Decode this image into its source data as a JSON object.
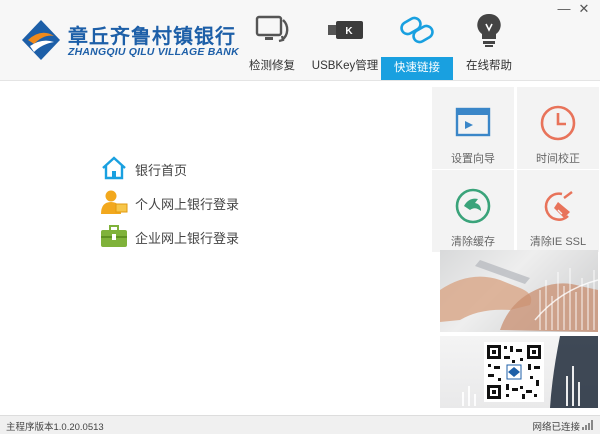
{
  "window": {
    "minimize_label": "—",
    "close_label": "✕"
  },
  "brand": {
    "name_cn": "章丘齐鲁村镇银行",
    "name_en": "ZHANGQIU QILU VILLAGE BANK"
  },
  "nav": [
    {
      "label": "检测修复",
      "icon": "monitor-repair-icon",
      "active": false
    },
    {
      "label": "USBKey管理",
      "icon": "usb-key-icon",
      "active": false
    },
    {
      "label": "快速链接",
      "icon": "link-icon",
      "active": true
    },
    {
      "label": "在线帮助",
      "icon": "lightbulb-icon",
      "active": false
    }
  ],
  "links": [
    {
      "label": "银行首页",
      "icon": "home-icon"
    },
    {
      "label": "个人网上银行登录",
      "icon": "personal-user-icon"
    },
    {
      "label": "企业网上银行登录",
      "icon": "briefcase-icon"
    }
  ],
  "tiles": [
    {
      "label": "设置向导",
      "icon": "setup-wizard-icon"
    },
    {
      "label": "时间校正",
      "icon": "clock-icon"
    },
    {
      "label": "清除缓存",
      "icon": "clear-cache-icon"
    },
    {
      "label": "清除IE SSL",
      "icon": "clear-ssl-icon"
    }
  ],
  "status": {
    "version": "主程序版本1.0.20.0513",
    "network": "网络已连接"
  },
  "colors": {
    "accent": "#19a0e0",
    "brand_blue": "#1d5fa8",
    "tile_red": "#e8735a",
    "tile_teal": "#3aa37a",
    "tile_blue": "#3a86c8"
  }
}
